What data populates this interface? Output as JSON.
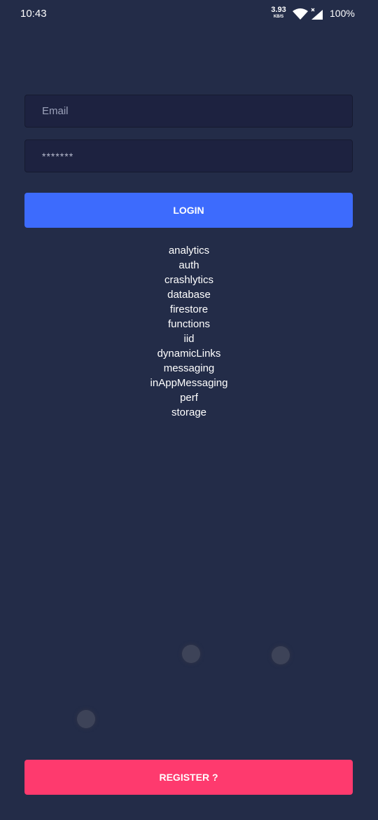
{
  "status_bar": {
    "time": "10:43",
    "net_speed_value": "3.93",
    "net_speed_unit": "KB/S",
    "battery": "100%",
    "icons": [
      "wifi-icon",
      "cellular-signal-icon"
    ]
  },
  "form": {
    "email_placeholder": "Email",
    "password_value": "*******"
  },
  "buttons": {
    "login_label": "LOGIN",
    "register_label": "REGISTER ?"
  },
  "modules": [
    "analytics",
    "auth",
    "crashlytics",
    "database",
    "firestore",
    "functions",
    "iid",
    "dynamicLinks",
    "messaging",
    "inAppMessaging",
    "perf",
    "storage"
  ],
  "colors": {
    "background": "#232c48",
    "input_background": "#1d2240",
    "login_button": "#3d6bfd",
    "register_button": "#fe3a6e"
  }
}
